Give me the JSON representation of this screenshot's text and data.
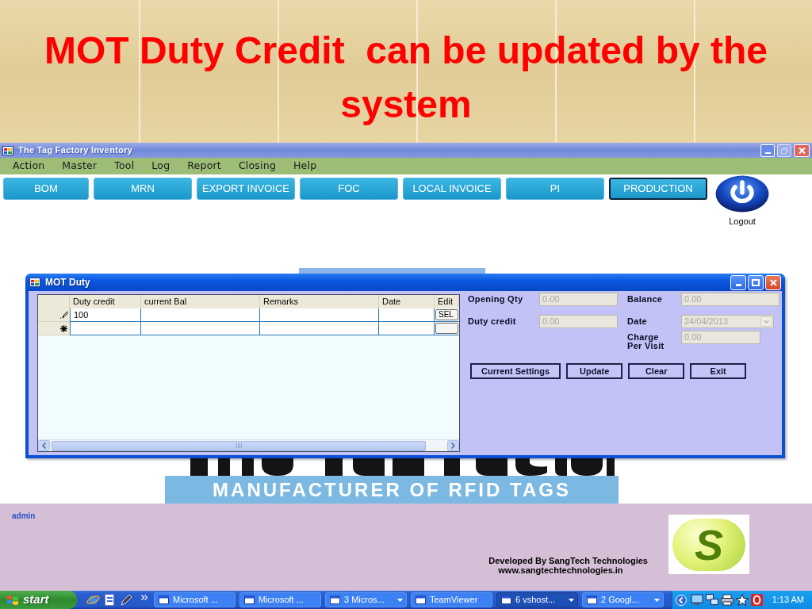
{
  "slide": {
    "title": "MOT Duty Credit  can be updated by the system"
  },
  "window": {
    "title": "The Tag Factory Inventory"
  },
  "menu": [
    "Action",
    "Master",
    "Tool",
    "Log",
    "Report",
    "Closing",
    "Help"
  ],
  "nav_buttons": [
    {
      "label": "BOM",
      "selected": false
    },
    {
      "label": "MRN",
      "selected": false
    },
    {
      "label": "EXPORT INVOICE",
      "selected": false
    },
    {
      "label": "FOC",
      "selected": false
    },
    {
      "label": "LOCAL INVOICE",
      "selected": false
    },
    {
      "label": "PI",
      "selected": false
    },
    {
      "label": "PRODUCTION",
      "selected": true
    }
  ],
  "logout": {
    "label": "Logout"
  },
  "logo": {
    "tagline": "MANUFACTURER OF RFID TAGS"
  },
  "dialog": {
    "title": "MOT Duty",
    "grid": {
      "columns": [
        "Duty credit",
        "current Bal",
        "Remarks",
        "Date",
        "Edit"
      ],
      "rows": [
        {
          "kind": "editing",
          "cells": [
            "100"
          ],
          "edit_button": "SEL"
        },
        {
          "kind": "new"
        }
      ]
    },
    "fields": [
      {
        "label": "Opening Qty",
        "value": "0.00",
        "kind": "text",
        "disabled": true
      },
      {
        "label": "Balance",
        "value": "0.00",
        "kind": "text",
        "disabled": true
      },
      {
        "label": "Duty credit",
        "value": "0.00",
        "kind": "text",
        "disabled": true
      },
      {
        "label": "Date",
        "value": "24/04/2013",
        "kind": "dropdown",
        "disabled": true
      },
      {
        "label": "Charge Per Visit",
        "value": "0.00",
        "kind": "text",
        "disabled": true
      }
    ],
    "buttons": [
      "Current Settings",
      "Update",
      "Clear",
      "Exit"
    ]
  },
  "footer": {
    "user": "admin",
    "credit": "Developed By SangTech Technologies",
    "website": "www.sangtechtechnologies.in",
    "logo_letter": "S"
  },
  "taskbar": {
    "start": "start",
    "tasks": [
      {
        "label": "Microsoft ...",
        "kind": "single",
        "selected": false
      },
      {
        "label": "Microsoft ...",
        "kind": "single",
        "selected": false
      },
      {
        "label": "3 Micros...",
        "kind": "group",
        "selected": false
      },
      {
        "label": "TeamViewer",
        "kind": "single",
        "selected": false
      },
      {
        "label": "6 vshost...",
        "kind": "group",
        "selected": true
      },
      {
        "label": "2 Googl...",
        "kind": "group",
        "selected": false
      }
    ],
    "clock": "1:13 AM"
  }
}
